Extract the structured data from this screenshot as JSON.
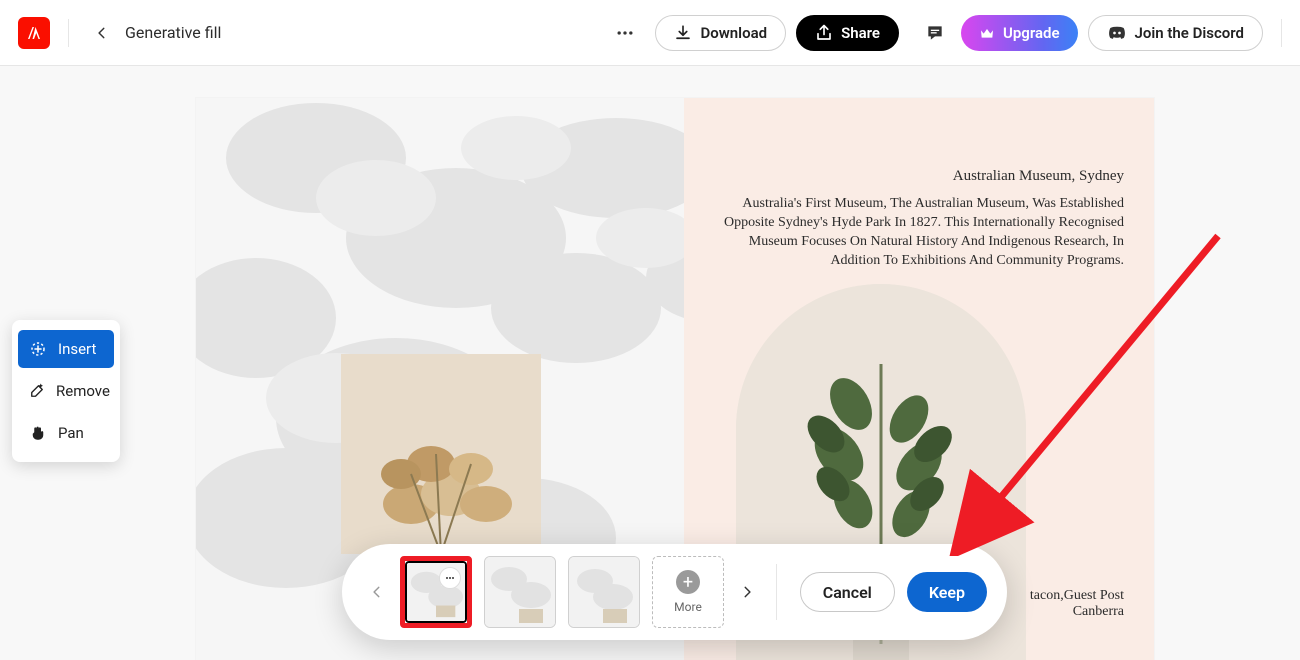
{
  "header": {
    "page_title": "Generative fill",
    "download_label": "Download",
    "share_label": "Share",
    "upgrade_label": "Upgrade",
    "discord_label": "Join the Discord"
  },
  "tools": {
    "insert": "Insert",
    "remove": "Remove",
    "pan": "Pan"
  },
  "canvas_text": {
    "title": "Australian Museum, Sydney",
    "body": "Australia's First Museum, The Australian Museum, Was Established Opposite Sydney's Hyde Park In 1827. This Internationally Recognised Museum Focuses On Natural History And Indigenous Research, In Addition To Exhibitions And Community Programs.",
    "caption_l1": "tacon,Guest Post",
    "caption_l2": "Canberra"
  },
  "action_bar": {
    "more_label": "More",
    "cancel_label": "Cancel",
    "keep_label": "Keep"
  }
}
